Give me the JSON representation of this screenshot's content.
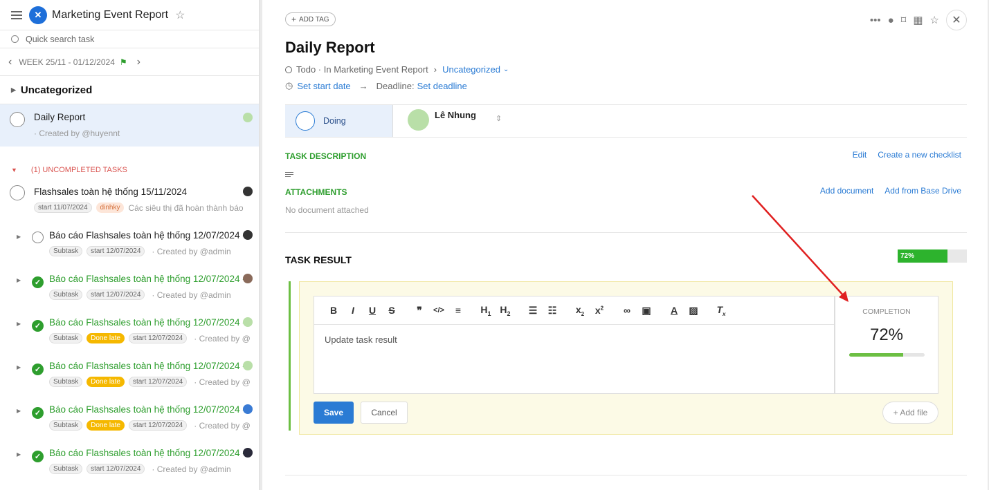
{
  "project": {
    "title": "Marketing Event Report"
  },
  "search": {
    "placeholder": "Quick search task"
  },
  "week": {
    "label": "WEEK 25/11 - 01/12/2024"
  },
  "category": "Uncategorized",
  "selected_task": {
    "title": "Daily Report",
    "sub": "· Created by @huyennt"
  },
  "uncompleted_label": "(1) UNCOMPLETED TASKS",
  "main_task": {
    "title": "Flashsales toàn hệ thống 15/11/2024",
    "tag_start": "start 11/07/2024",
    "tag_recurring": "dinhky",
    "desc": "Các siêu thị đã hoàn thành báo"
  },
  "subtasks": [
    {
      "title": "Báo cáo Flashsales toàn hệ thống 12/07/2024 -",
      "done": false,
      "tag": "Subtask",
      "late": "",
      "start": "start 12/07/2024",
      "created": "· Created by @admin"
    },
    {
      "title": "Báo cáo Flashsales toàn hệ thống 12/07/2024 -",
      "done": true,
      "tag": "Subtask",
      "late": "",
      "start": "start 12/07/2024",
      "created": "· Created by @admin"
    },
    {
      "title": "Báo cáo Flashsales toàn hệ thống 12/07/2024 -",
      "done": true,
      "tag": "Subtask",
      "late": "Done late",
      "start": "start 12/07/2024",
      "created": "· Created by @"
    },
    {
      "title": "Báo cáo Flashsales toàn hệ thống 12/07/2024 -",
      "done": true,
      "tag": "Subtask",
      "late": "Done late",
      "start": "start 12/07/2024",
      "created": "· Created by @"
    },
    {
      "title": "Báo cáo Flashsales toàn hệ thống 12/07/2024 -",
      "done": true,
      "tag": "Subtask",
      "late": "Done late",
      "start": "start 12/07/2024",
      "created": "· Created by @"
    },
    {
      "title": "Báo cáo Flashsales toàn hệ thống 12/07/2024 -",
      "done": true,
      "tag": "Subtask",
      "late": "",
      "start": "start 12/07/2024",
      "created": "· Created by @admin"
    }
  ],
  "detail": {
    "add_tag": "ADD TAG",
    "title": "Daily Report",
    "status_line": "Todo · In Marketing Event Report",
    "category": "Uncategorized",
    "set_start": "Set start date",
    "deadline_label": "Deadline:",
    "set_deadline": "Set deadline",
    "status": "Doing",
    "assignee": "Lê Nhung",
    "task_description": "TASK DESCRIPTION",
    "edit": "Edit",
    "create_checklist": "Create a new checklist",
    "attachments": "ATTACHMENTS",
    "add_document": "Add document",
    "add_from_drive": "Add from Base Drive",
    "no_document": "No document attached",
    "task_result": "TASK RESULT",
    "progress_text": "72%",
    "progress": 0.72,
    "editor_placeholder": "Update task result",
    "completion_label": "COMPLETION",
    "completion_value": "72%",
    "save": "Save",
    "cancel": "Cancel",
    "add_file": "+ Add file"
  },
  "colors": {
    "accent": "#2a7bd4",
    "green": "#2e9e2e",
    "late": "#f5b800",
    "arrow": "#e02020"
  }
}
